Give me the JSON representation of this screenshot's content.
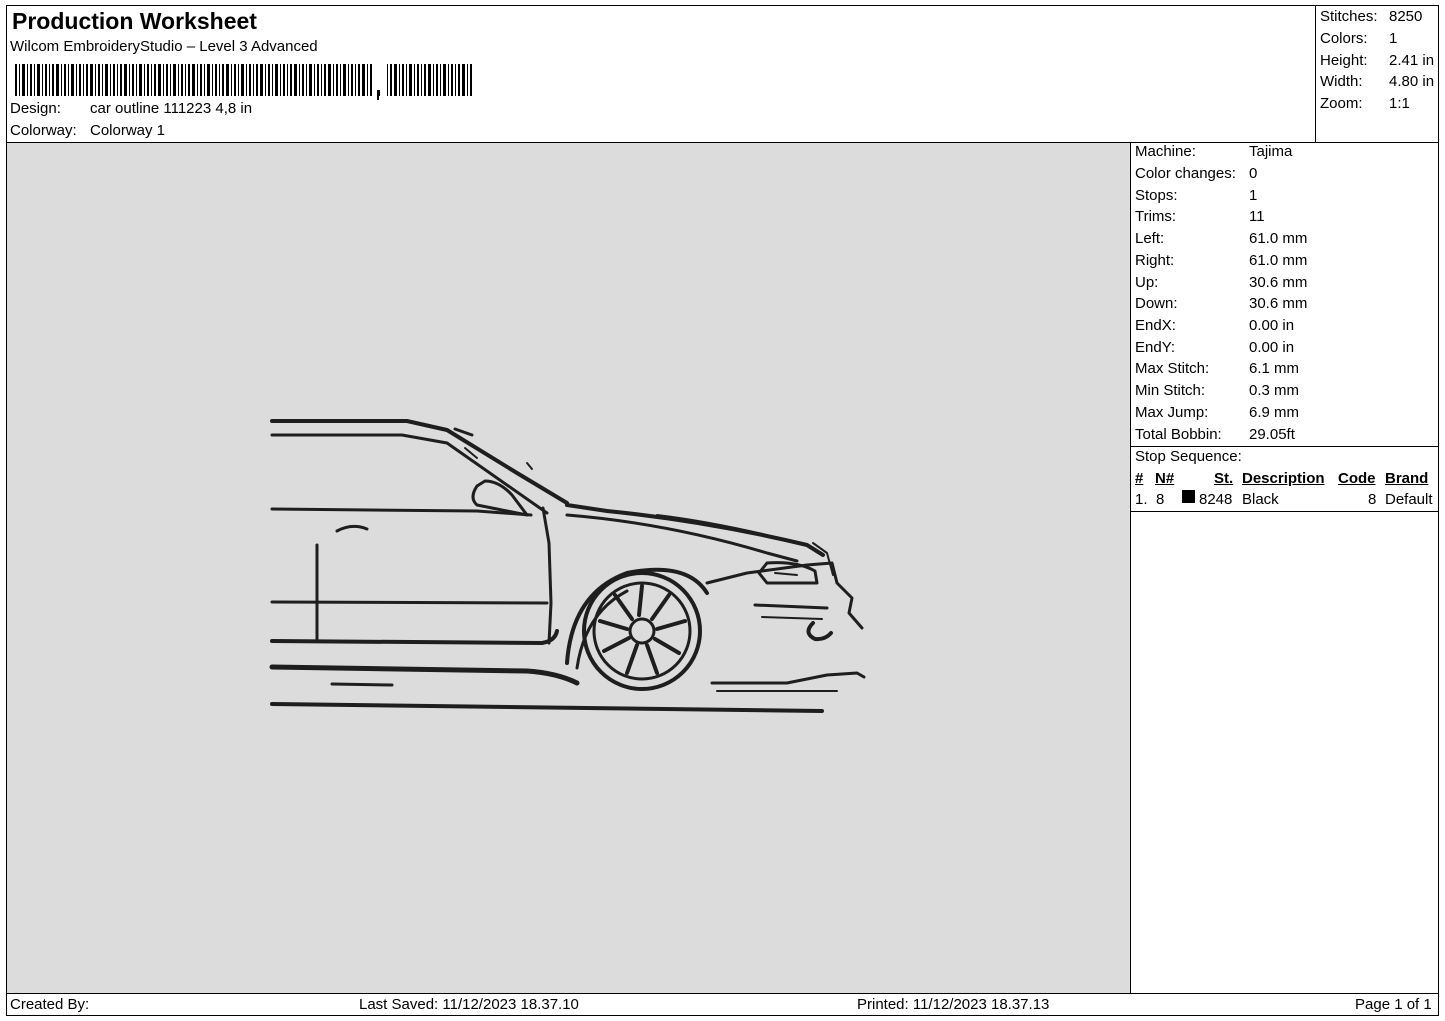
{
  "header": {
    "title": "Production Worksheet",
    "software": "Wilcom EmbroideryStudio – Level 3 Advanced",
    "design_label": "Design:",
    "design_value": "car outline 111223 4,8 in",
    "colorway_label": "Colorway:",
    "colorway_value": "Colorway 1"
  },
  "stats": {
    "stitches_label": "Stitches:",
    "stitches": "8250",
    "colors_label": "Colors:",
    "colors": "1",
    "height_label": "Height:",
    "height": "2.41 in",
    "width_label": "Width:",
    "width": "4.80 in",
    "zoom_label": "Zoom:",
    "zoom": "1:1"
  },
  "machine_info": [
    {
      "label": "Machine:",
      "value": "Tajima"
    },
    {
      "label": "Color changes:",
      "value": "0"
    },
    {
      "label": "Stops:",
      "value": "1"
    },
    {
      "label": "Trims:",
      "value": "11"
    },
    {
      "label": "Left:",
      "value": "61.0 mm"
    },
    {
      "label": "Right:",
      "value": "61.0 mm"
    },
    {
      "label": "Up:",
      "value": "30.6 mm"
    },
    {
      "label": "Down:",
      "value": "30.6 mm"
    },
    {
      "label": "EndX:",
      "value": "0.00 in"
    },
    {
      "label": "EndY:",
      "value": "0.00 in"
    },
    {
      "label": "Max Stitch:",
      "value": "6.1 mm"
    },
    {
      "label": "Min Stitch:",
      "value": "0.3 mm"
    },
    {
      "label": "Max Jump:",
      "value": "6.9 mm"
    },
    {
      "label": "Total Bobbin:",
      "value": "29.05ft"
    }
  ],
  "stop_sequence": {
    "title": "Stop Sequence:",
    "headers": {
      "num": "#",
      "n": "N#",
      "st": "St.",
      "description": "Description",
      "code": "Code",
      "brand": "Brand"
    },
    "rows": [
      {
        "num": "1.",
        "n": "8",
        "color": "#000000",
        "st": "8248",
        "description": "Black",
        "code": "8",
        "brand": "Default"
      }
    ]
  },
  "footer": {
    "created_by": "Created By:",
    "last_saved": "Last Saved: 11/12/2023 18.37.10",
    "printed": "Printed: 11/12/2023 18.37.13",
    "page": "Page 1 of 1"
  },
  "colors": {
    "canvas_bg": "#dcdcdc",
    "thread": "#1e1e1e"
  }
}
